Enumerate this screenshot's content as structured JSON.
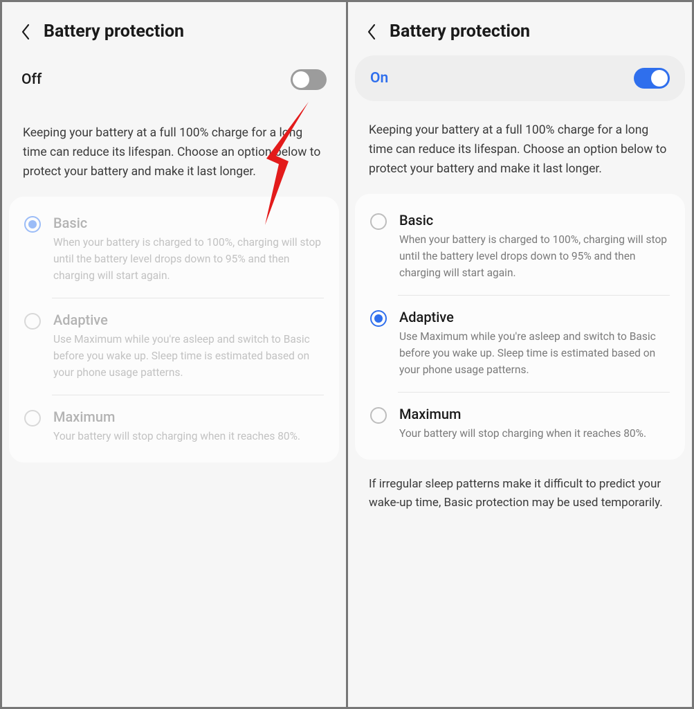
{
  "left": {
    "title": "Battery protection",
    "toggle": {
      "label": "Off",
      "state": "off"
    },
    "description": "Keeping your battery at a full 100% charge for a long time can reduce its lifespan. Choose an option below to protect your battery and make it last longer.",
    "options": [
      {
        "title": "Basic",
        "sub": "When your battery is charged to 100%, charging will stop until the battery level drops down to 95% and then charging will start again.",
        "selected": true
      },
      {
        "title": "Adaptive",
        "sub": "Use Maximum while you're asleep and switch to Basic before you wake up. Sleep time is estimated based on your phone usage patterns.",
        "selected": false
      },
      {
        "title": "Maximum",
        "sub": "Your battery will stop charging when it reaches 80%.",
        "selected": false
      }
    ]
  },
  "right": {
    "title": "Battery protection",
    "toggle": {
      "label": "On",
      "state": "on"
    },
    "description": "Keeping your battery at a full 100% charge for a long time can reduce its lifespan. Choose an option below to protect your battery and make it last longer.",
    "options": [
      {
        "title": "Basic",
        "sub": "When your battery is charged to 100%, charging will stop until the battery level drops down to 95% and then charging will start again.",
        "selected": false
      },
      {
        "title": "Adaptive",
        "sub": "Use Maximum while you're asleep and switch to Basic before you wake up. Sleep time is estimated based on your phone usage patterns.",
        "selected": true
      },
      {
        "title": "Maximum",
        "sub": "Your battery will stop charging when it reaches 80%.",
        "selected": false
      }
    ],
    "footnote": "If irregular sleep patterns make it difficult to predict your wake-up time, Basic protection may be used temporarily."
  },
  "annotation": {
    "arrow_color": "#e31b1b"
  }
}
